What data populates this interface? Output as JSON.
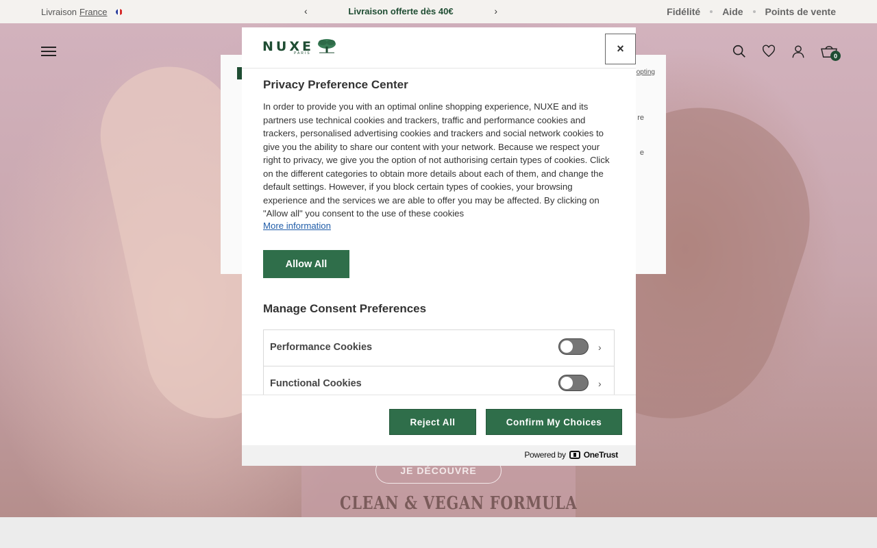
{
  "topbar": {
    "delivery_prefix": "Livraison",
    "delivery_country": "France",
    "promo": "Livraison offerte dès 40€",
    "prev_arrow": "‹",
    "next_arrow": "›",
    "links": [
      "Fidélité",
      "Aide",
      "Points de vente"
    ]
  },
  "header": {
    "cart_count": "0",
    "icons": [
      "menu-icon",
      "search-icon",
      "heart-icon",
      "account-icon",
      "cart-icon"
    ]
  },
  "background": {
    "link_fragment": "opting",
    "text_fragments": [
      "re",
      "e"
    ],
    "cta": "JE DÉCOUVRE",
    "tagline": "CLEAN & VEGAN FORMULA"
  },
  "modal": {
    "brand": "NUXE",
    "brand_sub": "PARIS",
    "close_label": "×",
    "title": "Privacy Preference Center",
    "description": "In order to provide you with an optimal online shopping experience, NUXE and its partners use technical cookies and trackers, traffic and performance cookies and trackers, personalised advertising cookies and trackers and social network cookies to give you the ability to share our content with your network. Because we respect your right to privacy, we give you the option of not authorising certain types of cookies. Click on the different categories to obtain more details about each of them, and change the default settings. However, if you block certain types of cookies, your browsing experience and the services we are able to offer you may be affected. By clicking on \"Allow all\" you consent to the use of these cookies",
    "more_info": "More information",
    "allow_all": "Allow All",
    "manage_title": "Manage Consent Preferences",
    "categories": [
      {
        "label": "Performance Cookies",
        "enabled": false
      },
      {
        "label": "Functional Cookies",
        "enabled": false
      }
    ],
    "reject_all": "Reject All",
    "confirm": "Confirm My Choices",
    "powered_by": "Powered by",
    "powered_brand": "OneTrust"
  },
  "colors": {
    "brand_green": "#2f6e4a",
    "dark_green": "#1f4d33",
    "link_blue": "#1f5ca8"
  }
}
